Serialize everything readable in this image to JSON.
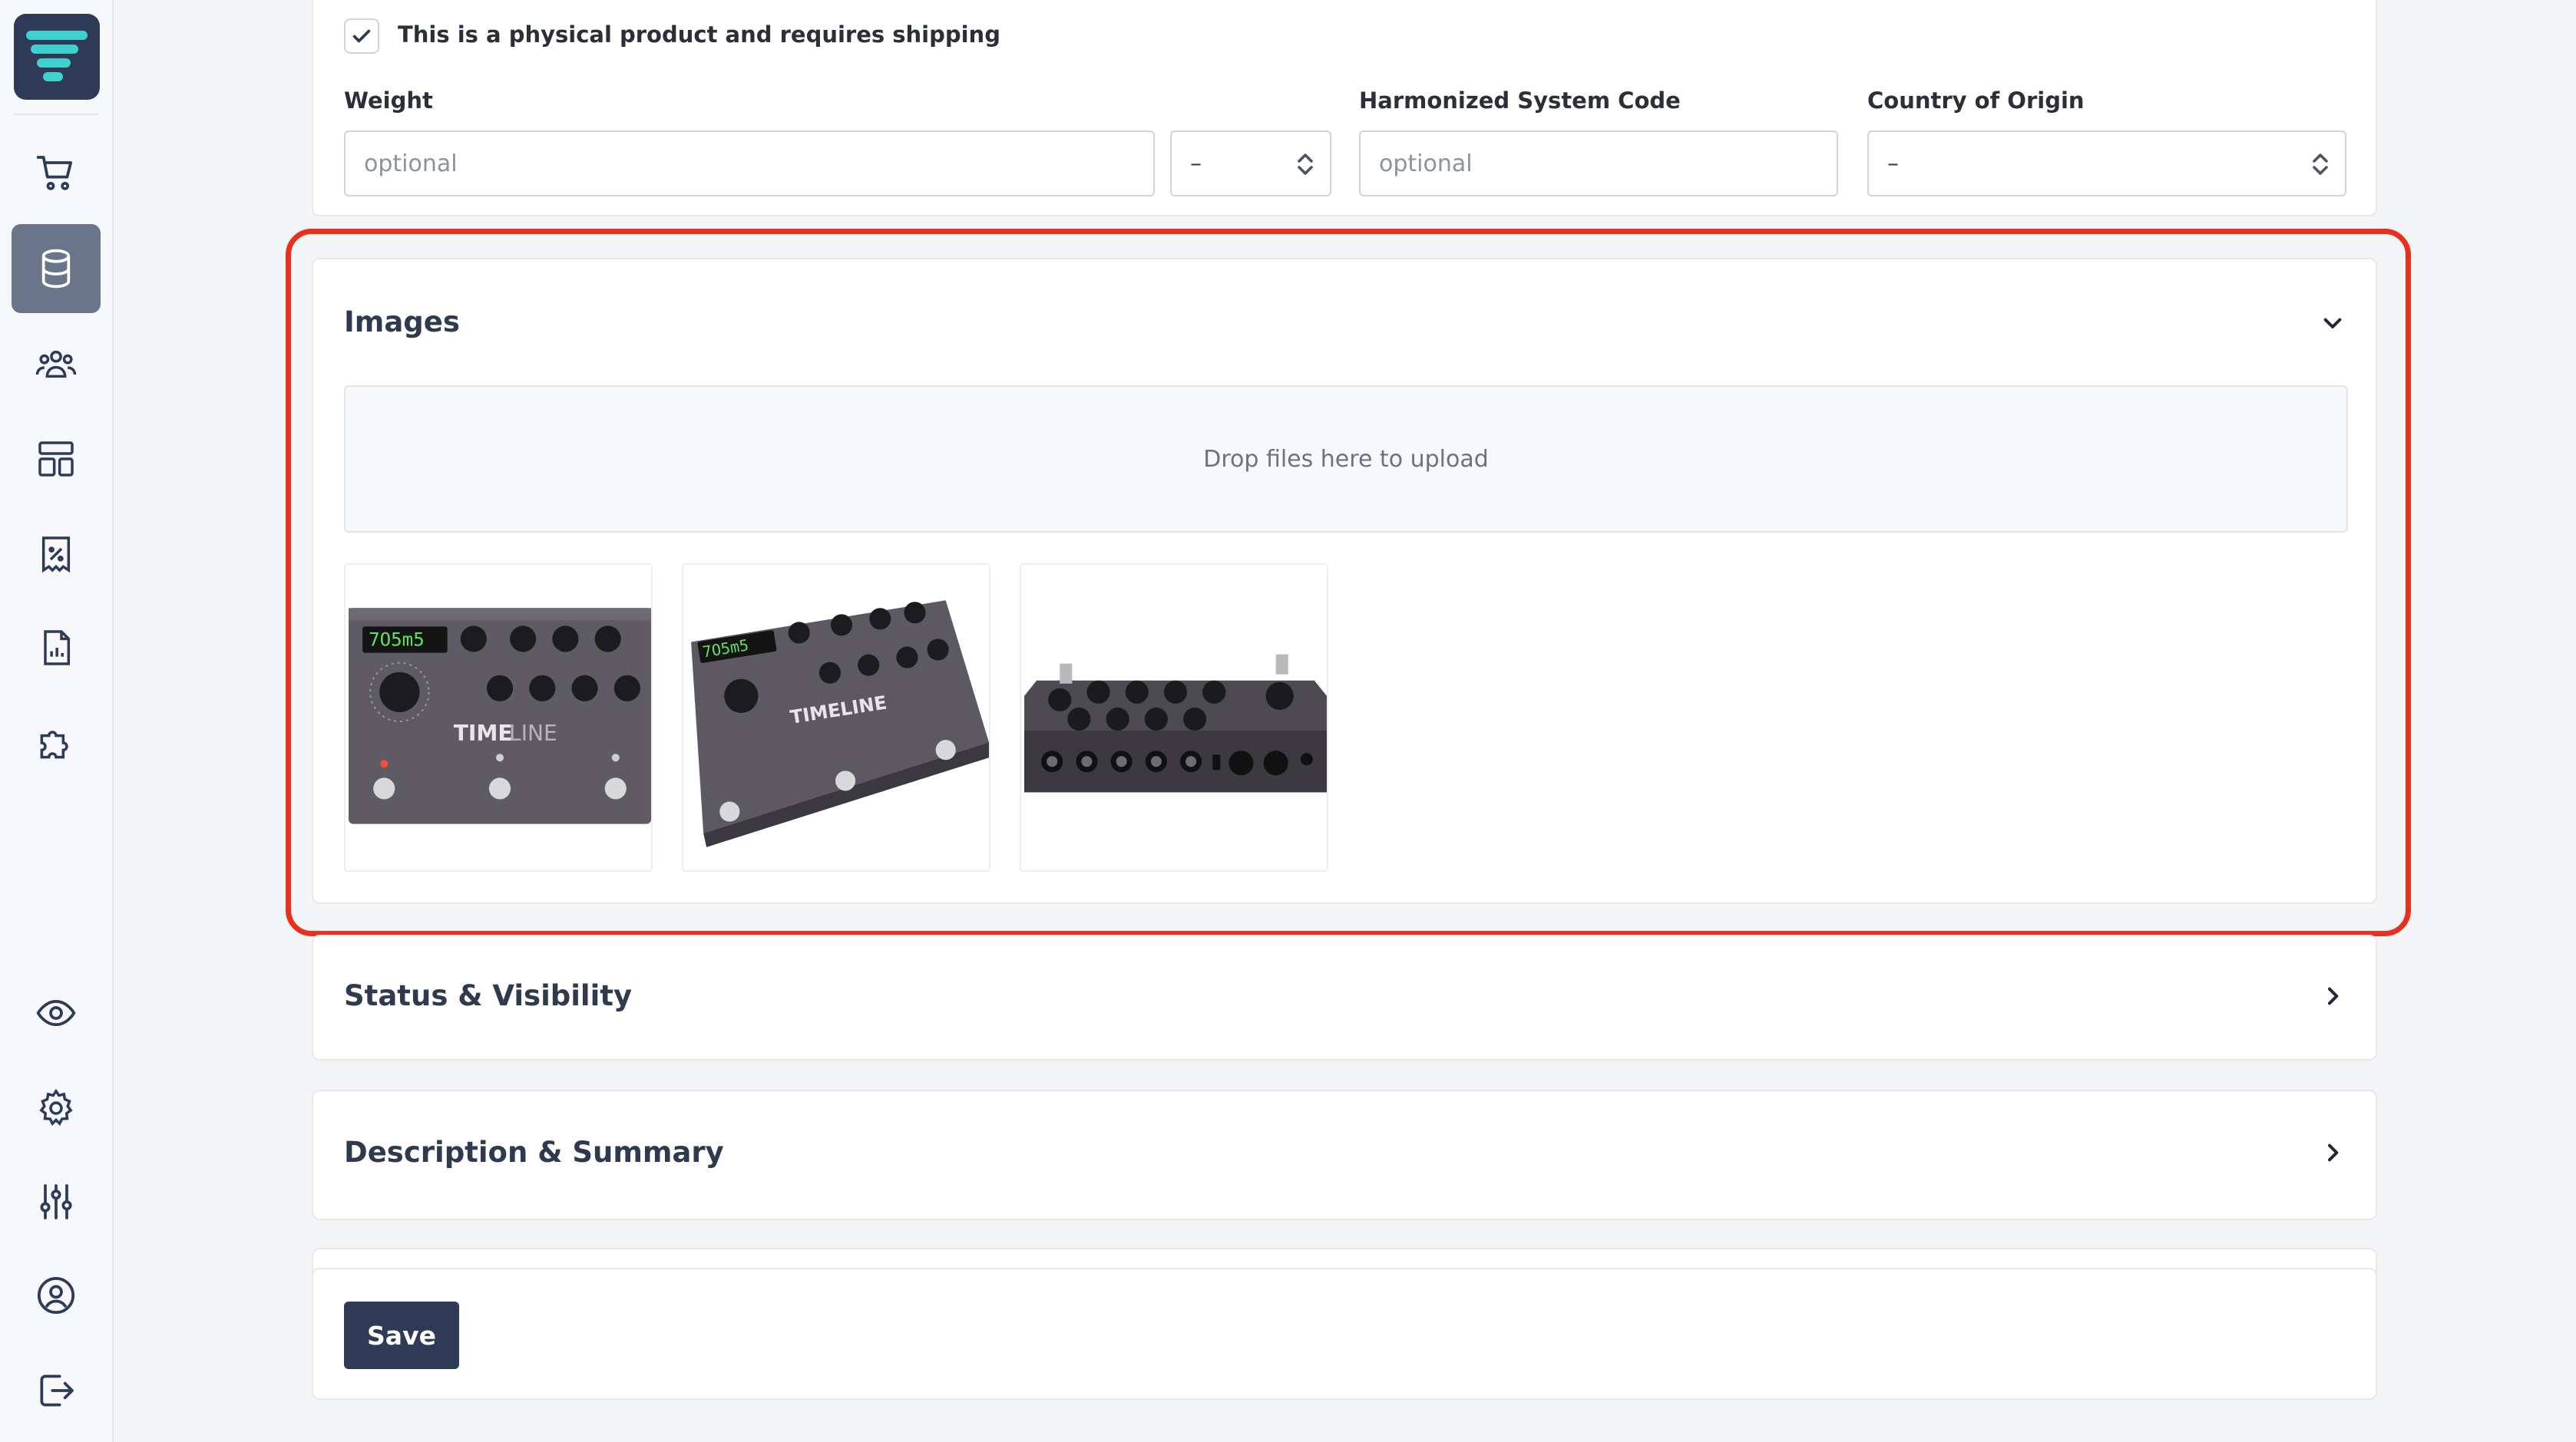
{
  "sidebar": {
    "top_icons": [
      "logo-icon",
      "cart-icon",
      "database-icon",
      "users-icon",
      "layout-icon",
      "receipt-icon",
      "report-icon",
      "puzzle-icon"
    ],
    "bottom_icons": [
      "eye-icon",
      "gear-icon",
      "sliders-icon",
      "user-circle-icon",
      "logout-icon"
    ],
    "active": "database-icon"
  },
  "shipping": {
    "checkbox_label": "This is a physical product and requires shipping",
    "checked": true,
    "weight_label": "Weight",
    "weight_placeholder": "optional",
    "weight_unit_value": "–",
    "hs_label": "Harmonized System Code",
    "hs_placeholder": "optional",
    "country_label": "Country of Origin",
    "country_value": "–"
  },
  "images": {
    "title": "Images",
    "dropzone_text": "Drop files here to upload",
    "thumbnails": [
      "pedal-front-image",
      "pedal-angled-image",
      "pedal-back-image"
    ]
  },
  "status": {
    "title": "Status & Visibility"
  },
  "description": {
    "title": "Description & Summary"
  },
  "actions": {
    "save_label": "Save"
  },
  "colors": {
    "highlight": "#e8301c",
    "primary": "#2f3a57",
    "active_nav": "#6b7589"
  }
}
